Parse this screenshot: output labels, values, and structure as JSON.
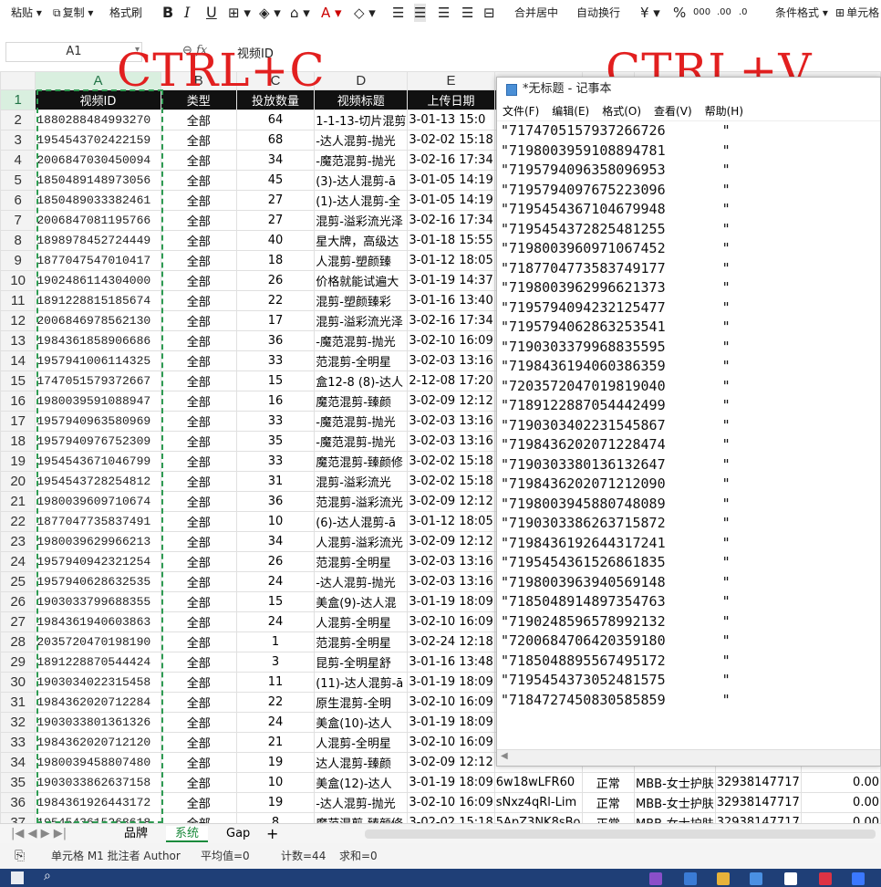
{
  "ribbon": {
    "paste": "粘贴",
    "copy": "复制",
    "format_painter": "格式刷",
    "merge_center": "合并居中",
    "wrap": "自动换行",
    "cond_format": "条件格式",
    "cell_style": "单元格"
  },
  "formula_bar": {
    "cell_ref": "A1",
    "fx": "fx",
    "value": "视频ID"
  },
  "overlay": {
    "left": "CTRL+C",
    "right": "CTRL+V"
  },
  "columns": [
    "",
    "A",
    "B",
    "C",
    "D",
    "E"
  ],
  "header_row": [
    "视频ID",
    "类型",
    "投放数量",
    "视频标题",
    "上传日期"
  ],
  "rows": [
    [
      "1880288484993270",
      "全部",
      "64",
      "1-1-13-切片混剪",
      "3-01-13 15:0"
    ],
    [
      "1954543702422159",
      "全部",
      "68",
      "-达人混剪-抛光",
      "3-02-02 15:18"
    ],
    [
      "2006847030450094",
      "全部",
      "34",
      "-魔范混剪-抛光",
      "3-02-16 17:34"
    ],
    [
      "1850489148973056",
      "全部",
      "45",
      "(3)-达人混剪-ā",
      "3-01-05 14:19"
    ],
    [
      "1850489033382461",
      "全部",
      "27",
      "(1)-达人混剪-全",
      "3-01-05 14:19"
    ],
    [
      "2006847081195766",
      "全部",
      "27",
      "混剪-溢彩流光泽",
      "3-02-16 17:34"
    ],
    [
      "1898978452724449",
      "全部",
      "40",
      "星大牌，高级达",
      "3-01-18 15:55"
    ],
    [
      "1877047547010417",
      "全部",
      "18",
      "人混剪-塑颜臻",
      "3-01-12 18:05"
    ],
    [
      "1902486114304000",
      "全部",
      "26",
      "价格就能试遍大",
      "3-01-19 14:37"
    ],
    [
      "1891228815185674",
      "全部",
      "22",
      "混剪-塑颜臻彩",
      "3-01-16 13:40"
    ],
    [
      "2006846978562130",
      "全部",
      "17",
      "混剪-溢彩流光泽",
      "3-02-16 17:34"
    ],
    [
      "1984361858906686",
      "全部",
      "36",
      "-魔范混剪-抛光",
      "3-02-10 16:09"
    ],
    [
      "1957941006114325",
      "全部",
      "33",
      "范混剪-全明星",
      "3-02-03 13:16"
    ],
    [
      "1747051579372667",
      "全部",
      "15",
      "盒12-8 (8)-达人",
      "2-12-08 17:20"
    ],
    [
      "1980039591088947",
      "全部",
      "16",
      "魔范混剪-臻颜",
      "3-02-09 12:12"
    ],
    [
      "1957940963580969",
      "全部",
      "33",
      "-魔范混剪-抛光",
      "3-02-03 13:16"
    ],
    [
      "1957940976752309",
      "全部",
      "35",
      "-魔范混剪-抛光",
      "3-02-03 13:16"
    ],
    [
      "1954543671046799",
      "全部",
      "33",
      "魔范混剪-臻颜修",
      "3-02-02 15:18"
    ],
    [
      "1954543728254812",
      "全部",
      "31",
      "混剪-溢彩流光",
      "3-02-02 15:18"
    ],
    [
      "1980039609710674",
      "全部",
      "36",
      "范混剪-溢彩流光",
      "3-02-09 12:12"
    ],
    [
      "1877047735837491",
      "全部",
      "10",
      "(6)-达人混剪-ā",
      "3-01-12 18:05"
    ],
    [
      "1980039629966213",
      "全部",
      "34",
      "人混剪-溢彩流光",
      "3-02-09 12:12"
    ],
    [
      "1957940942321254",
      "全部",
      "26",
      "范混剪-全明星",
      "3-02-03 13:16"
    ],
    [
      "1957940628632535",
      "全部",
      "24",
      "-达人混剪-抛光",
      "3-02-03 13:16"
    ],
    [
      "1903033799688355",
      "全部",
      "15",
      "美盒(9)-达人混",
      "3-01-19 18:09"
    ],
    [
      "1984361940603863",
      "全部",
      "24",
      "人混剪-全明星",
      "3-02-10 16:09"
    ],
    [
      "2035720470198190",
      "全部",
      "1",
      "范混剪-全明星",
      "3-02-24 12:18"
    ],
    [
      "1891228870544424",
      "全部",
      "3",
      "昆剪-全明星舒",
      "3-01-16 13:48"
    ],
    [
      "1903034022315458",
      "全部",
      "11",
      "(11)-达人混剪-ā",
      "3-01-19 18:09"
    ],
    [
      "1984362020712284",
      "全部",
      "22",
      "原生混剪-全明",
      "3-02-10 16:09"
    ],
    [
      "1903033801361326",
      "全部",
      "24",
      "美盒(10)-达人",
      "3-01-19 18:09"
    ],
    [
      "1984362020712120",
      "全部",
      "21",
      "人混剪-全明星",
      "3-02-10 16:09"
    ],
    [
      "1980039458807480",
      "全部",
      "19",
      "达人混剪-臻颜",
      "3-02-09 12:12"
    ],
    [
      "1903033862637158",
      "全部",
      "10",
      "美盒(12)-达人",
      "3-01-19 18:09"
    ],
    [
      "1984361926443172",
      "全部",
      "19",
      "-达人混剪-抛光",
      "3-02-10 16:09"
    ],
    [
      "1954543615268618",
      "全部",
      "8",
      "魔范混剪-臻颜修",
      "3-02-02 15:18"
    ]
  ],
  "partial_right": [
    [
      "6w18wLFR60",
      "正常",
      "MBB-女士护肤",
      "32938147717",
      "0.00"
    ],
    [
      "sNxz4qRl-Lim",
      "正常",
      "MBB-女士护肤",
      "32938147717",
      "0.00"
    ],
    [
      "5ApZ3NK8sBo",
      "正常",
      "MBB-女士护肤",
      "32938147717",
      "0.00"
    ]
  ],
  "notepad": {
    "title": "*无标题 - 记事本",
    "menu": [
      "文件(F)",
      "编辑(E)",
      "格式(O)",
      "查看(V)",
      "帮助(H)"
    ],
    "lines": [
      "\"7174705157937266726",
      "\"7198003959108894781",
      "\"7195794096358096953",
      "\"7195794097675223096",
      "\"7195454367104679948",
      "\"7195454372825481255",
      "\"7198003960971067452",
      "\"7187704773583749177",
      "\"7198003962996621373",
      "\"7195794094232125477",
      "\"7195794062863253541",
      "\"7190303379968835595",
      "\"7198436194060386359",
      "\"7203572047019819040",
      "\"7189122887054442499",
      "\"7190303402231545867",
      "\"7198436202071228474",
      "\"7190303380136132647",
      "\"7198436202071212090",
      "\"7198003945880748089",
      "\"7190303386263715872",
      "\"7198436192644317241",
      "\"7195454361526861835",
      "\"7198003963940569148",
      "\"7185048914897354763",
      "\"7190248596578992132",
      "\"7200684706420359180",
      "\"7185048895567495172",
      "\"7195454373052481575",
      "\"7184727450830585859"
    ],
    "trail_quote": "\""
  },
  "sheet_tabs": [
    "品牌",
    "系统",
    "Gap",
    "+"
  ],
  "status": {
    "cell_note": "单元格 M1 批注者 Author",
    "avg": "平均值=0",
    "count": "计数=44",
    "sum": "求和=0"
  }
}
